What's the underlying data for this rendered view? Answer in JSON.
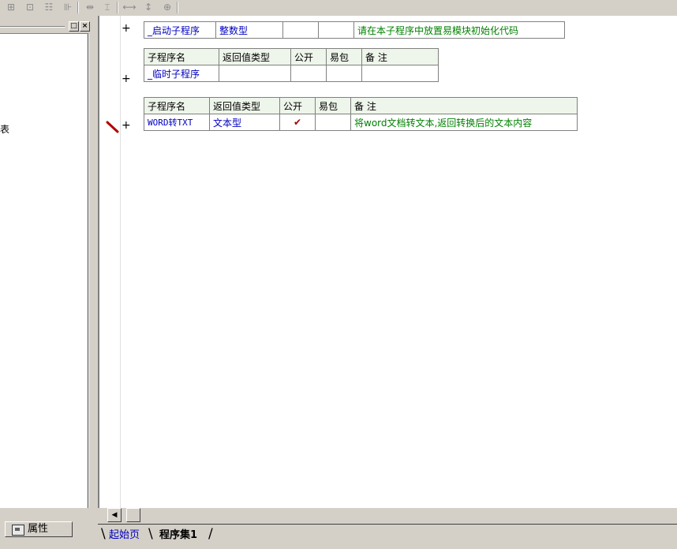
{
  "toolbar": {
    "icons": [
      "align-left-icon",
      "align-center-icon",
      "align-top-icon",
      "align-bottom-icon",
      "space-horizontal-icon",
      "space-vertical-icon",
      "same-width-icon",
      "same-height-icon",
      "same-size-icon"
    ]
  },
  "left_panel": {
    "partial_text": "表",
    "property_tab_label": "属性"
  },
  "code": {
    "sub1": {
      "name": "_启动子程序",
      "return_type": "整数型",
      "public": "",
      "easy_pkg": "",
      "note": "请在本子程序中放置易模块初始化代码"
    },
    "sub2": {
      "headers": [
        "子程序名",
        "返回值类型",
        "公开",
        "易包",
        "备 注"
      ],
      "name": "_临时子程序",
      "return_type": "",
      "public": "",
      "easy_pkg": "",
      "note": ""
    },
    "sub3": {
      "headers": [
        "子程序名",
        "返回值类型",
        "公开",
        "易包",
        "备 注"
      ],
      "name": "WORD转TXT",
      "return_type": "文本型",
      "public": "✔",
      "easy_pkg": "",
      "note": "将word文档转文本,返回转换后的文本内容"
    },
    "plus": "+"
  },
  "tabs": {
    "start_page": "起始页",
    "program_set": "程序集1"
  },
  "scroll": {
    "left_arrow": "◀"
  }
}
